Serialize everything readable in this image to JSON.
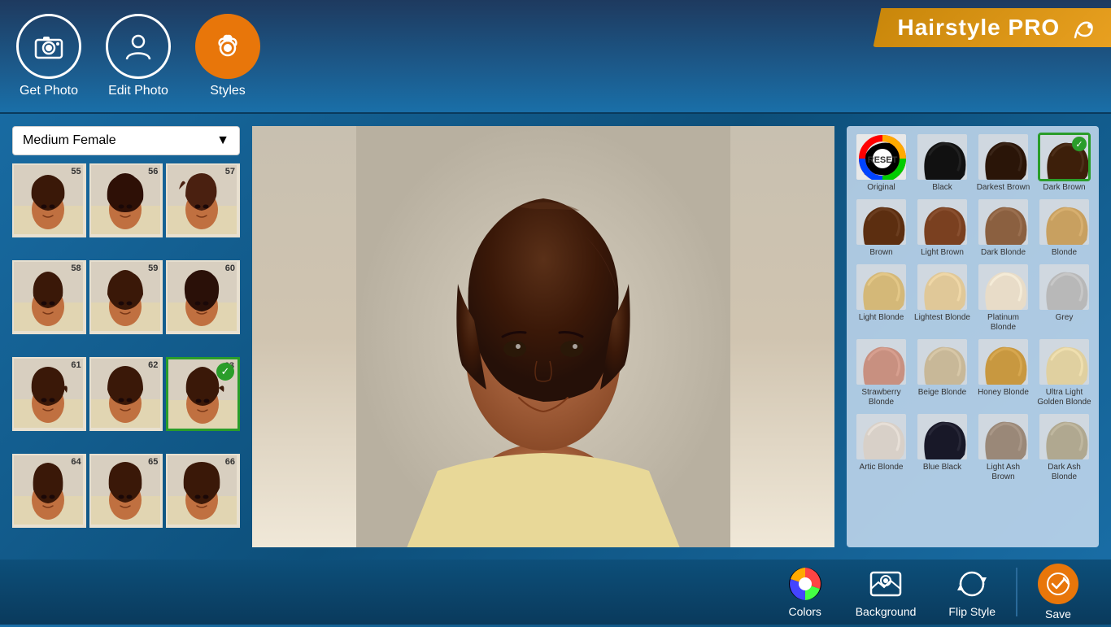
{
  "app": {
    "title": "Hairstyle PRO"
  },
  "header": {
    "nav": [
      {
        "id": "get-photo",
        "label": "Get Photo",
        "icon": "📷",
        "active": false
      },
      {
        "id": "edit-photo",
        "label": "Edit Photo",
        "icon": "👤",
        "active": false
      },
      {
        "id": "styles",
        "label": "Styles",
        "icon": "💇",
        "active": true
      }
    ]
  },
  "styles_panel": {
    "dropdown_label": "Medium Female",
    "items": [
      {
        "num": "55",
        "selected": false
      },
      {
        "num": "56",
        "selected": false
      },
      {
        "num": "57",
        "selected": false
      },
      {
        "num": "58",
        "selected": false
      },
      {
        "num": "59",
        "selected": false
      },
      {
        "num": "60",
        "selected": false
      },
      {
        "num": "61",
        "selected": false
      },
      {
        "num": "62",
        "selected": false
      },
      {
        "num": "63",
        "selected": true
      },
      {
        "num": "64",
        "selected": false
      },
      {
        "num": "65",
        "selected": false
      },
      {
        "num": "66",
        "selected": false
      }
    ]
  },
  "colors": [
    {
      "id": "original",
      "label": "Original",
      "type": "reset",
      "selected": false
    },
    {
      "id": "black",
      "label": "Black",
      "color": "#111111",
      "selected": false
    },
    {
      "id": "darkest-brown",
      "label": "Darkest Brown",
      "color": "#2a1508",
      "selected": false
    },
    {
      "id": "dark-brown",
      "label": "Dark Brown",
      "color": "#3d1f0a",
      "selected": true
    },
    {
      "id": "brown",
      "label": "Brown",
      "color": "#5c2e10",
      "selected": false
    },
    {
      "id": "light-brown",
      "label": "Light Brown",
      "color": "#7a4020",
      "selected": false
    },
    {
      "id": "dark-blonde",
      "label": "Dark Blonde",
      "color": "#8b6040",
      "selected": false
    },
    {
      "id": "blonde",
      "label": "Blonde",
      "color": "#c8a060",
      "selected": false
    },
    {
      "id": "light-blonde",
      "label": "Light Blonde",
      "color": "#d4b878",
      "selected": false
    },
    {
      "id": "lightest-blonde",
      "label": "Lightest Blonde",
      "color": "#e0c898",
      "selected": false
    },
    {
      "id": "platinum-blonde",
      "label": "Platinum Blonde",
      "color": "#e8dcc8",
      "selected": false
    },
    {
      "id": "grey",
      "label": "Grey",
      "color": "#b8b8b8",
      "selected": false
    },
    {
      "id": "strawberry-blonde",
      "label": "Strawberry Blonde",
      "color": "#c89080",
      "selected": false
    },
    {
      "id": "beige-blonde",
      "label": "Beige Blonde",
      "color": "#c8b898",
      "selected": false
    },
    {
      "id": "honey-blonde",
      "label": "Honey Blonde",
      "color": "#c89840",
      "selected": false
    },
    {
      "id": "ultra-light-golden-blonde",
      "label": "Ultra Light Golden Blonde",
      "color": "#e0d0a0",
      "selected": false
    },
    {
      "id": "artic-blonde",
      "label": "Artic Blonde",
      "color": "#d8d0c8",
      "selected": false
    },
    {
      "id": "blue-black",
      "label": "Blue Black",
      "color": "#181828",
      "selected": false
    },
    {
      "id": "light-ash-brown",
      "label": "Light Ash Brown",
      "color": "#9a8878",
      "selected": false
    },
    {
      "id": "dark-ash-blonde",
      "label": "Dark Ash Blonde",
      "color": "#b0a890",
      "selected": false
    }
  ],
  "toolbar": {
    "colors_label": "Colors",
    "background_label": "Background",
    "flip_style_label": "Flip Style",
    "save_label": "Save"
  }
}
